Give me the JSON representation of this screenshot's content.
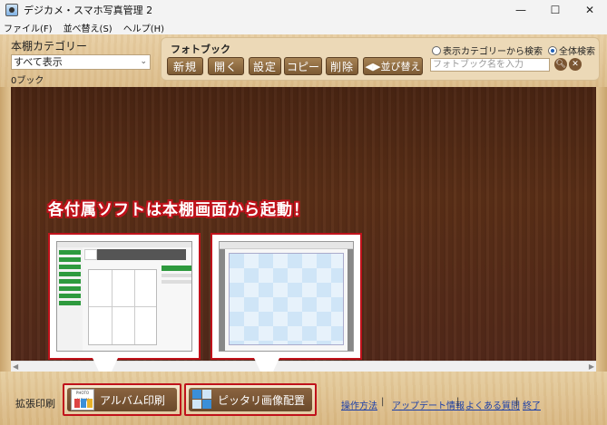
{
  "window": {
    "title": "デジカメ・スマホ写真管理 2",
    "minimize": "—",
    "maximize": "☐",
    "close": "✕"
  },
  "menu": [
    "ファイル(F)",
    "並べ替え(S)",
    "ヘルプ(H)"
  ],
  "category": {
    "label": "本棚カテゴリー",
    "selected": "すべて表示",
    "book_count": "0ブック"
  },
  "photobook": {
    "label": "フォトブック",
    "buttons": [
      "新規",
      "開く",
      "設定",
      "コピー",
      "削除",
      "◀▶並び替え"
    ],
    "search_scope": [
      "表示カテゴリーから検索",
      "全体検索"
    ],
    "search_scope_selected": "全体検索",
    "search_placeholder": "フォトブック名を入力"
  },
  "callout": {
    "text": "各付属ソフトは本棚画面から起動！"
  },
  "extensions": {
    "label": "拡張印刷",
    "album_print": "アルバム印刷",
    "album_icon_text": "PHOTO ALBUM",
    "pittari": "ピッタリ画像配置"
  },
  "footer_links": [
    "操作方法",
    "アップデート情報",
    "よくある質問",
    "終了"
  ],
  "colors": {
    "accent_red": "#c0121b",
    "shelf_dark": "#53291a",
    "wood_light": "#e6cd9f",
    "button_brown": "#7c5a33"
  }
}
